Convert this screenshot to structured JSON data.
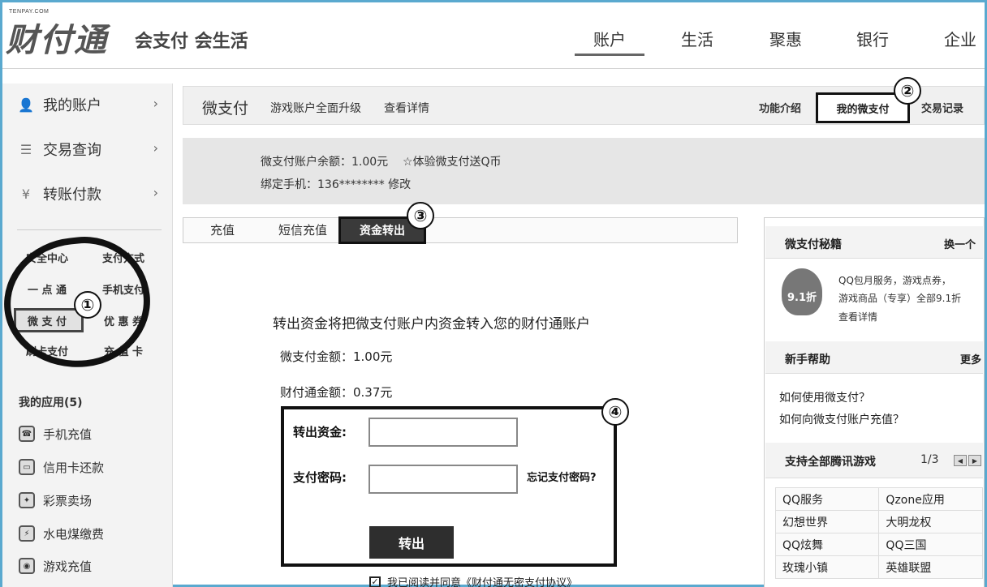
{
  "header": {
    "logo_small": "TENPAY.COM",
    "logo_main": "财付通",
    "slogan": "会支付 会生活",
    "nav": [
      "账户",
      "生活",
      "聚惠",
      "银行",
      "企业"
    ]
  },
  "sidebar": {
    "main_items": [
      "我的账户",
      "交易查询",
      "转账付款"
    ],
    "arrow": "›",
    "grid": [
      [
        "安全中心",
        "支付方式"
      ],
      [
        "一 点 通",
        "手机支付"
      ],
      [
        "微 支 付",
        "优 惠 券"
      ],
      [
        "刷卡支付",
        "充 值 卡"
      ]
    ],
    "apps_title": "我的应用(5)",
    "apps": [
      "手机充值",
      "信用卡还款",
      "彩票卖场",
      "水电煤缴费",
      "游戏充值"
    ]
  },
  "markers": [
    "①",
    "②",
    "③",
    "④"
  ],
  "topbar": {
    "title": "微支付",
    "upgrade": "游戏账户全面升级",
    "detail": "查看详情",
    "intro": "功能介绍",
    "my_weizhifu": "我的微支付",
    "records": "交易记录"
  },
  "balance": {
    "line1": "微支付账户余额：1.00元    ☆体验微支付送Q币",
    "line2": "绑定手机：136******** 修改"
  },
  "tabs": {
    "recharge": "充值",
    "sms_recharge": "短信充值",
    "transfer_out": "资金转出"
  },
  "transfer": {
    "description": "转出资金将把微支付账户内资金转入您的财付通账户",
    "wzf_amount": "微支付金额：1.00元",
    "cft_amount": "财付通金额：0.37元",
    "amount_label": "转出资金:",
    "amount_value": "",
    "password_label": "支付密码:",
    "password_value": "",
    "forgot_password": "忘记支付密码?",
    "submit": "转出",
    "agree_text": "我已阅读并同意《财付通无密支付协议》",
    "agree_checked": "✓"
  },
  "right_panel": {
    "secrets_title": "微支付秘籍",
    "secrets_switch": "换一个",
    "promo_badge": "9.1折",
    "promo_lines": [
      "QQ包月服务，游戏点券，",
      "游戏商品（专享）全部9.1折",
      "查看详情"
    ],
    "help_title": "新手帮助",
    "help_more": "更多",
    "help_links": [
      "如何使用微支付？",
      "如何向微支付账户充值？"
    ],
    "games_title": "支持全部腾讯游戏",
    "games_page": "1/3",
    "pager_prev": "◀",
    "pager_next": "▶",
    "games": [
      [
        "QQ服务",
        "Qzone应用"
      ],
      [
        "幻想世界",
        "大明龙权"
      ],
      [
        "QQ炫舞",
        "QQ三国"
      ],
      [
        "玫瑰小镇",
        "英雄联盟"
      ]
    ]
  }
}
